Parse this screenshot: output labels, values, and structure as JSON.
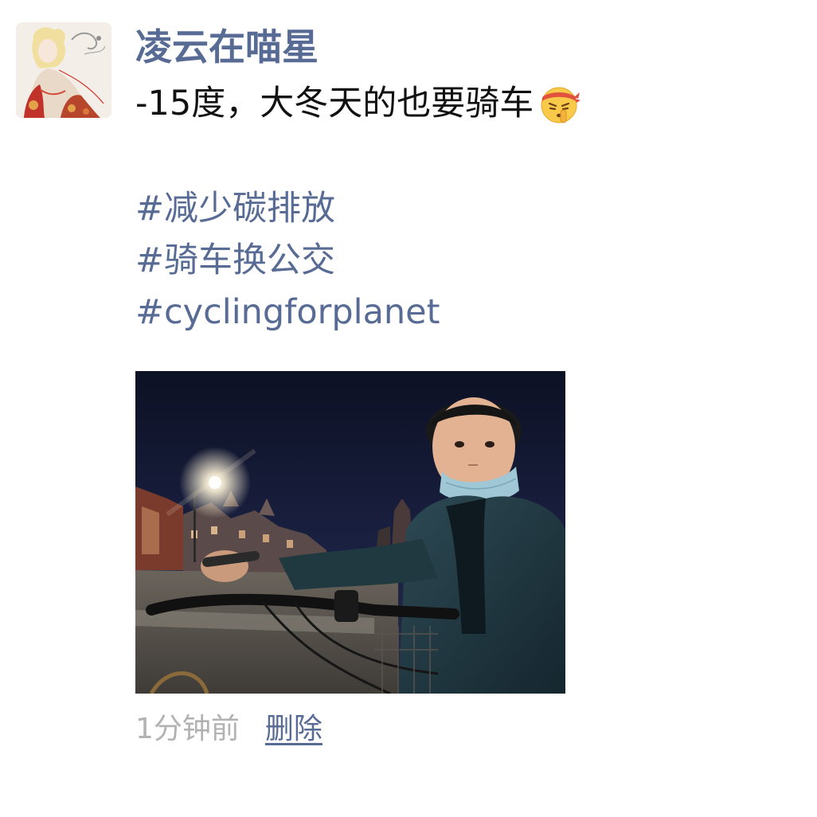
{
  "post": {
    "username": "凌云在喵星",
    "text": "-15度，大冬天的也要骑车",
    "emoji": "shushing-face-with-headband-icon",
    "hashtags": [
      "#减少碳排放",
      "#骑车换公交",
      "#cyclingforplanet"
    ],
    "photo": "cycling-selfie-night-photo",
    "timestamp": "1分钟前",
    "delete_label": "删除"
  },
  "colors": {
    "link": "#576b95",
    "text": "#111111",
    "timestamp": "#b2b2b2",
    "background": "#ffffff"
  }
}
